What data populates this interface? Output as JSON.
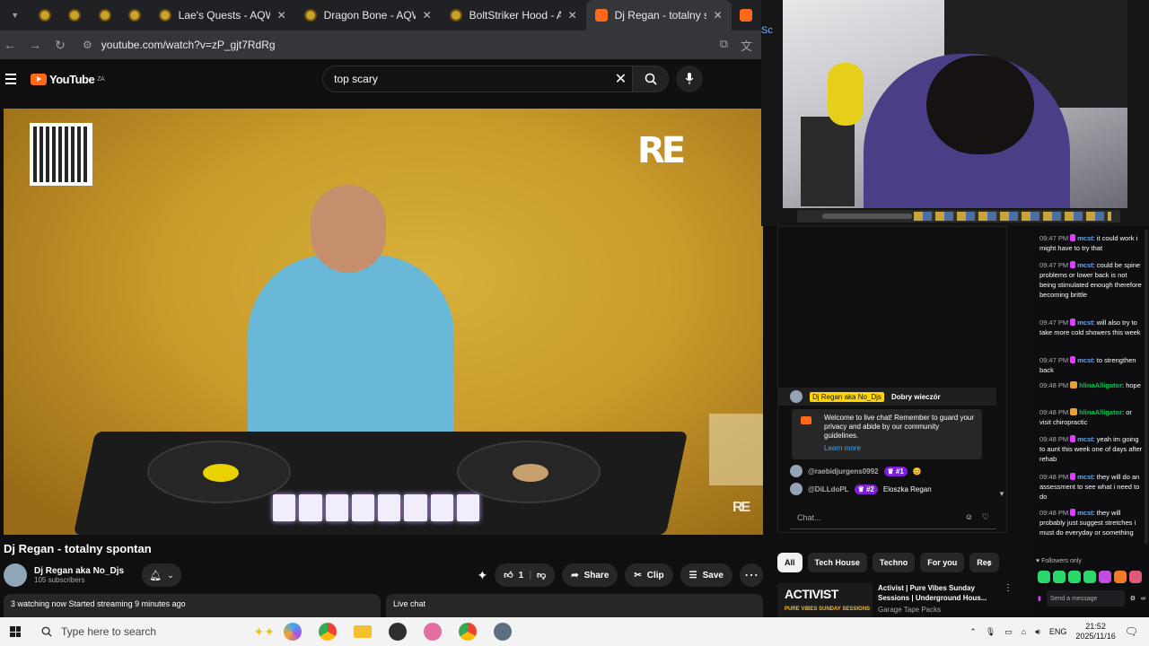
{
  "browser": {
    "pinned_tab_count": 4,
    "tabs": [
      {
        "label": "Lae's Quests - AQW"
      },
      {
        "label": "Dragon Bone - AQW"
      },
      {
        "label": "BoltStriker Hood - AQW"
      },
      {
        "label": "Dj Regan - totalny spontan",
        "active": true
      }
    ],
    "url": "youtube.com/watch?v=zP_gjt7RdRg"
  },
  "youtube": {
    "logo": "YouTube",
    "region": "ZA",
    "search_value": "top scary"
  },
  "video": {
    "title": "Dj Regan - totalny spontan",
    "overlay_logo": "RE",
    "channel": {
      "name": "Dj Regan aka No_Djs",
      "subs": "105 subscribers"
    },
    "likes": "1",
    "share_label": "Share",
    "clip_label": "Clip",
    "save_label": "Save",
    "stats": "3 watching now  Started streaming 9 minutes ago",
    "live_chat_label": "Live chat"
  },
  "webcam": {
    "side_text": "Sc"
  },
  "mid_chat": {
    "pinned": {
      "author": "Dj Regan aka No_Djs",
      "text": "Dobry wieczór"
    },
    "welcome": {
      "text": "Welcome to live chat! Remember to guard your privacy and abide by our community guidelines.",
      "link": "Learn more"
    },
    "messages": [
      {
        "author": "@raebidjurgens0992",
        "badge": "#1",
        "text": ""
      },
      {
        "author": "@DiLLdoPL",
        "badge": "#2",
        "text": "Eloszka Regan"
      }
    ],
    "input_placeholder": "Chat..."
  },
  "chips": [
    {
      "label": "All",
      "active": true
    },
    {
      "label": "Tech House"
    },
    {
      "label": "Techno"
    },
    {
      "label": "For you"
    },
    {
      "label": "Rec"
    }
  ],
  "recommended": {
    "thumb_big": "ACTIVIST",
    "thumb_small": "PURE VIBES SUNDAY SESSIONS",
    "title": "Activist | Pure Vibes Sunday Sessions | Underground Hous...",
    "channel": "Garage Tape Packs"
  },
  "right_chat": {
    "messages": [
      {
        "time": "09:47 PM",
        "user": "mcst",
        "text": "it could work i might have to try that"
      },
      {
        "time": "09:47 PM",
        "user": "mcst",
        "text": "could be spine problems or lower back is not being stimulated enough therefore becoming brittle"
      },
      {
        "time": "09:47 PM",
        "user": "mcst",
        "text": "will also try to take more cold showers this week"
      },
      {
        "time": "09:47 PM",
        "user": "mcst",
        "text": "to strengthen back"
      },
      {
        "time": "09:48 PM",
        "user": "hlinaAlligator",
        "text": "hope"
      },
      {
        "time": "09:48 PM",
        "user": "hlinaAlligator",
        "text": "or visit chiropractic"
      },
      {
        "time": "09:48 PM",
        "user": "mcst",
        "text": "yeah im going to aunt this week one of days after rehab"
      },
      {
        "time": "09:48 PM",
        "user": "mcst",
        "text": "they will do an assessment to see what i need to do"
      },
      {
        "time": "09:48 PM",
        "user": "mcst",
        "text": "they will probably just suggest stretches i must do everyday or something"
      }
    ],
    "followers_only": "Followers only",
    "send_placeholder": "Send a message"
  },
  "taskbar": {
    "search_placeholder": "Type here to search",
    "language": "ENG",
    "time": "21:52",
    "date": "2025/11/16"
  }
}
